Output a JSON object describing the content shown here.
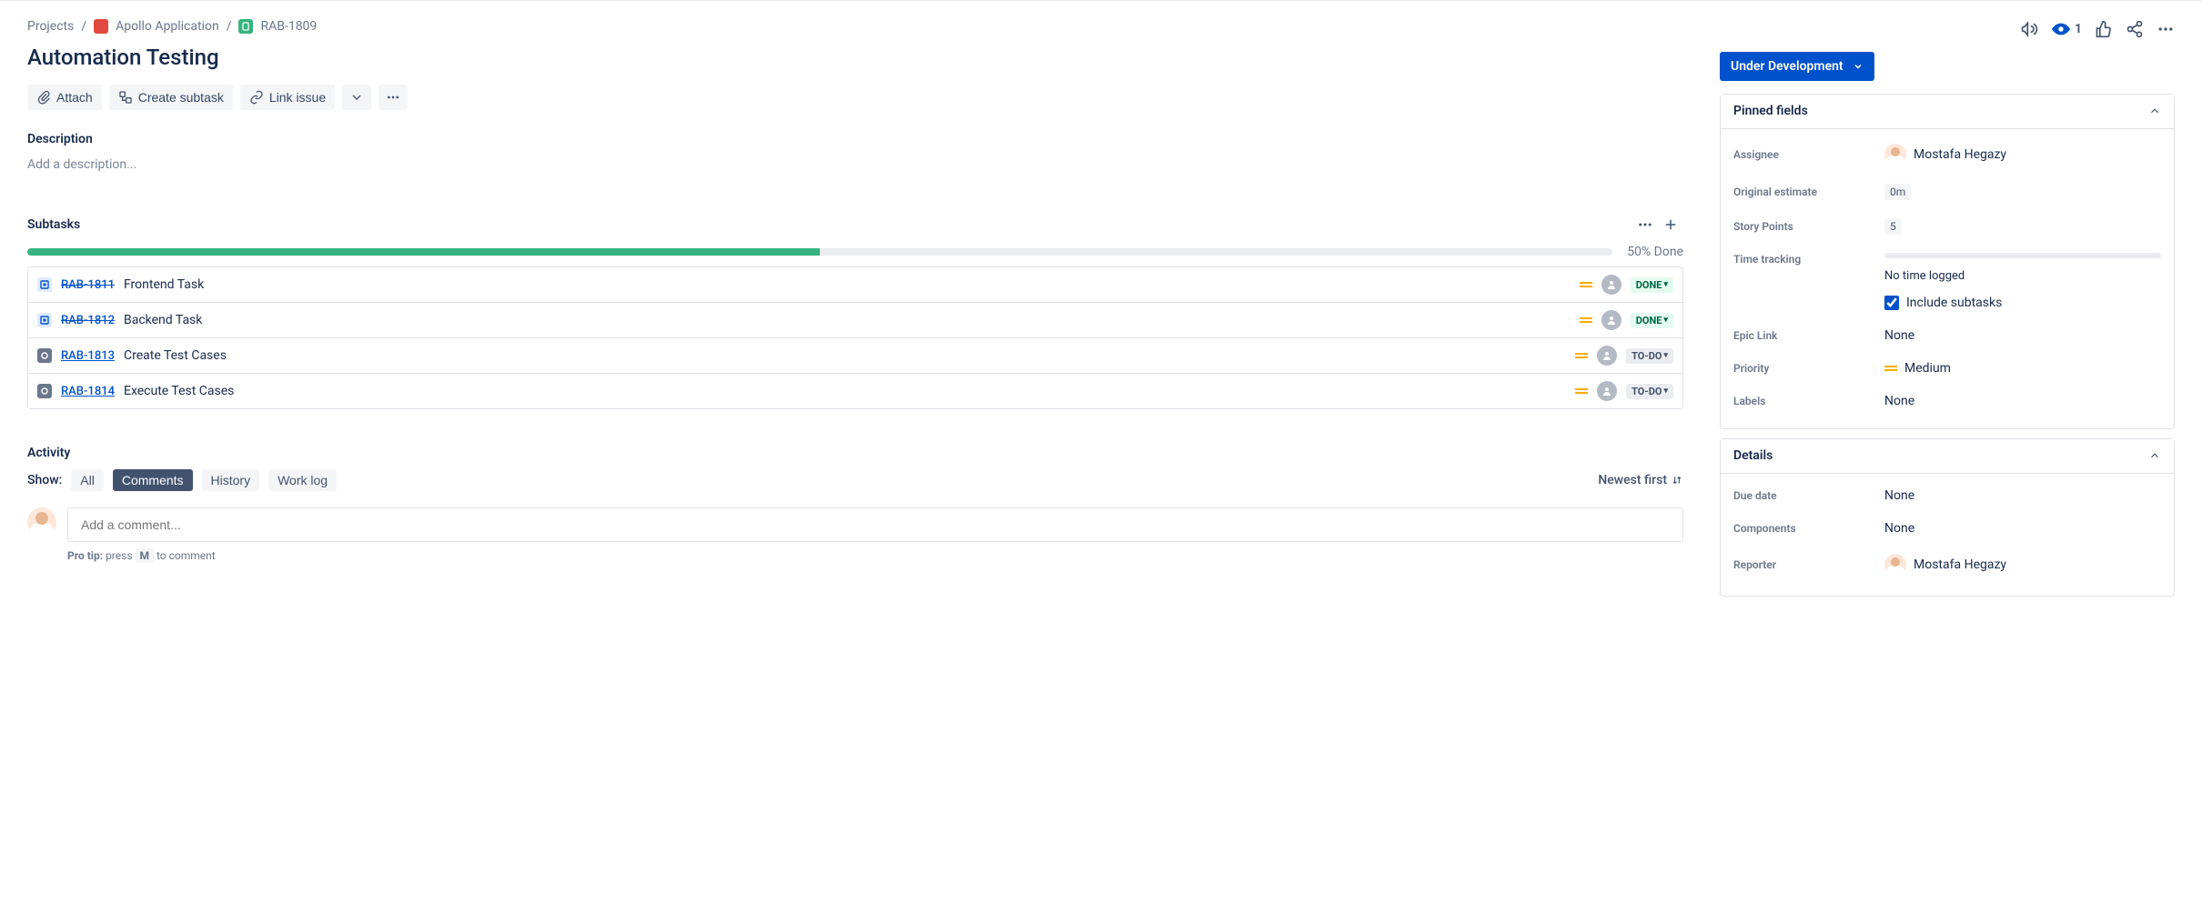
{
  "breadcrumb": {
    "projects": "Projects",
    "project_name": "Apollo Application",
    "issue_key": "RAB-1809"
  },
  "issue_title": "Automation Testing",
  "toolbar": {
    "attach": "Attach",
    "create_subtask": "Create subtask",
    "link_issue": "Link issue"
  },
  "description": {
    "label": "Description",
    "placeholder": "Add a description..."
  },
  "subtasks": {
    "label": "Subtasks",
    "progress_pct": 50,
    "progress_text": "50% Done",
    "items": [
      {
        "key": "RAB-1811",
        "summary": "Frontend Task",
        "status": "DONE",
        "done": true,
        "icon": "blue"
      },
      {
        "key": "RAB-1812",
        "summary": "Backend Task",
        "status": "DONE",
        "done": true,
        "icon": "blue"
      },
      {
        "key": "RAB-1813",
        "summary": "Create Test Cases",
        "status": "TO-DO",
        "done": false,
        "icon": "gray"
      },
      {
        "key": "RAB-1814",
        "summary": "Execute Test Cases",
        "status": "TO-DO",
        "done": false,
        "icon": "gray"
      }
    ]
  },
  "activity": {
    "label": "Activity",
    "show_label": "Show:",
    "tabs": {
      "all": "All",
      "comments": "Comments",
      "history": "History",
      "worklog": "Work log"
    },
    "sort_label": "Newest first",
    "comment_placeholder": "Add a comment...",
    "protip_strong": "Pro tip:",
    "protip_press": "press",
    "protip_key": "M",
    "protip_rest": "to comment"
  },
  "header": {
    "watch_count": "1"
  },
  "status_button": "Under Development",
  "pinned": {
    "header": "Pinned fields",
    "assignee_label": "Assignee",
    "assignee_value": "Mostafa Hegazy",
    "original_estimate_label": "Original estimate",
    "original_estimate_value": "0m",
    "story_points_label": "Story Points",
    "story_points_value": "5",
    "time_tracking_label": "Time tracking",
    "time_tracking_value": "No time logged",
    "include_subtasks": "Include subtasks",
    "epic_link_label": "Epic Link",
    "epic_link_value": "None",
    "priority_label": "Priority",
    "priority_value": "Medium",
    "labels_label": "Labels",
    "labels_value": "None"
  },
  "details": {
    "header": "Details",
    "due_date_label": "Due date",
    "due_date_value": "None",
    "components_label": "Components",
    "components_value": "None",
    "reporter_label": "Reporter",
    "reporter_value": "Mostafa Hegazy"
  }
}
